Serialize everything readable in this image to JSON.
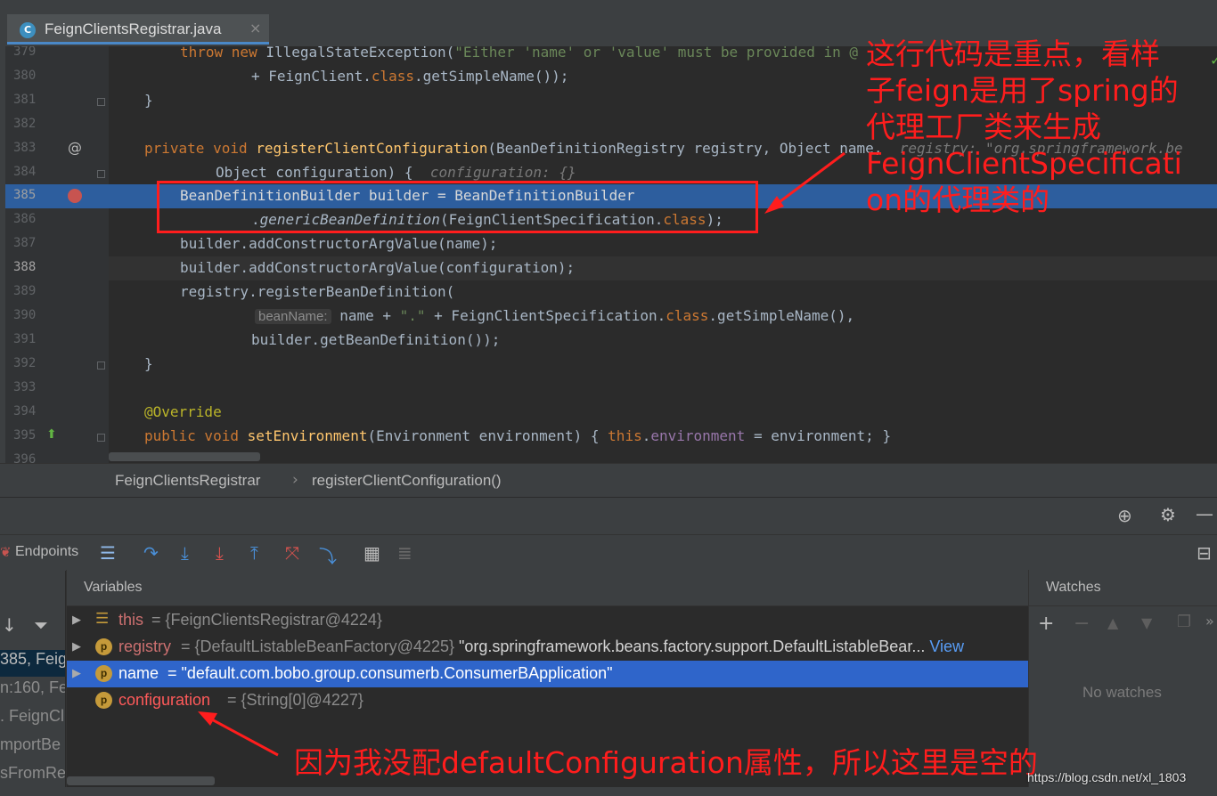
{
  "tab": {
    "file_name": "FeignClientsRegistrar.java",
    "close_glyph": "×"
  },
  "editor": {
    "lines": [
      {
        "num": "379"
      },
      {
        "num": "380"
      },
      {
        "num": "381"
      },
      {
        "num": "382"
      },
      {
        "num": "383"
      },
      {
        "num": "384"
      },
      {
        "num": "385"
      },
      {
        "num": "386"
      },
      {
        "num": "387"
      },
      {
        "num": "388"
      },
      {
        "num": "389"
      },
      {
        "num": "390"
      },
      {
        "num": "391"
      },
      {
        "num": "392"
      },
      {
        "num": "393"
      },
      {
        "num": "394"
      },
      {
        "num": "395"
      },
      {
        "num": "396"
      }
    ],
    "code": {
      "l379": "throw new IllegalStateException(\"Either 'name' or 'value' must be provided in @",
      "l380": "+ FeignClient.class.getSimpleName());",
      "l381": "}",
      "l383_sig": "private void registerClientConfiguration(BeanDefinitionRegistry registry, Object name,",
      "l383_hint": "registry: \"org.springframework.be",
      "l384": "Object configuration) {",
      "l384_hint": "configuration: {}",
      "l385": "BeanDefinitionBuilder builder = BeanDefinitionBuilder",
      "l386": ".genericBeanDefinition(FeignClientSpecification.class);",
      "l387": "builder.addConstructorArgValue(name);",
      "l388": "builder.addConstructorArgValue(configuration);",
      "l389": "registry.registerBeanDefinition(",
      "l390_param": "beanName:",
      "l390": "name + \".\" + FeignClientSpecification.class.getSimpleName(),",
      "l391": "builder.getBeanDefinition());",
      "l392": "}",
      "l394": "@Override",
      "l395": "public void setEnvironment(Environment environment) { this.environment = environment; }"
    },
    "gutter_icons": {
      "l383": "@",
      "l395": "⬆"
    }
  },
  "breadcrumb": {
    "class_name": "FeignClientsRegistrar",
    "separator": "›",
    "method_name": "registerClientConfiguration()"
  },
  "debug": {
    "endpoints_label": "Endpoints",
    "variables_header": "Variables",
    "watches_header": "Watches",
    "no_watches": "No watches",
    "variables": [
      {
        "name": "this",
        "value": "{FeignClientsRegistrar@4224}",
        "icon": "fields-icon"
      },
      {
        "name": "registry",
        "value": "{DefaultListableBeanFactory@4225}",
        "string": "\"org.springframework.beans.factory.support.DefaultListableBear...",
        "link": "View",
        "icon": "p"
      },
      {
        "name": "name",
        "value": "\"default.com.bobo.group.consumerb.ConsumerBApplication\"",
        "icon": "p"
      },
      {
        "name": "configuration",
        "value": "{String[0]@4227}",
        "icon": "p"
      }
    ],
    "frames": [
      "",
      "385, Feig",
      "n:160, Fe",
      ". FeignCl",
      "mportBe",
      "sFromRe"
    ]
  },
  "annotations": {
    "top_note": [
      "这行代码是重点，看样",
      "子feign是用了spring的",
      "代理工厂类来生成",
      "FeignClientSpecificati",
      "on的代理类的"
    ],
    "bottom_note": "因为我没配defaultConfiguration属性，所以这里是空的"
  },
  "watermark": "https://blog.csdn.net/xl_1803",
  "colors": {
    "highlight": "#2d5e9e",
    "annotation_red": "#ff1d1d",
    "keyword": "#cc7832",
    "method": "#ffc66d",
    "string": "#6a8759"
  }
}
